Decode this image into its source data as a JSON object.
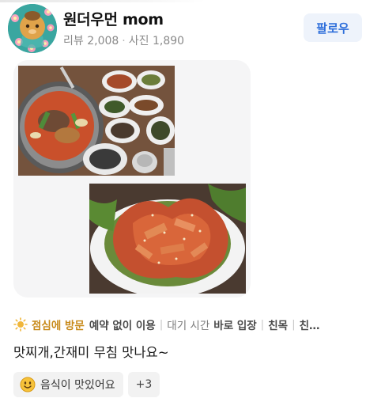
{
  "profile": {
    "username": "원더우먼 mom",
    "reviews_label": "리뷰 2,008",
    "photos_label": "사진 1,890",
    "separator": "·",
    "follow_label": "팔로우"
  },
  "visit_tags": {
    "time": "점심에 방문",
    "reservation": "예약 없이 이용",
    "wait_label": "대기 시간",
    "wait_value": "바로 입장",
    "purpose": "친목",
    "overflow": "친…",
    "divider": "|"
  },
  "review": {
    "text": "맛찌개,간재미 무침 맛나요~"
  },
  "keyword_chips": {
    "first": "음식이 맛있어요",
    "more": "+3"
  },
  "colors": {
    "follow_text": "#2f6fdb",
    "follow_bg": "#eef3fb",
    "highlight": "#c88a1a",
    "avatar_bg": "#3aa6a0"
  }
}
